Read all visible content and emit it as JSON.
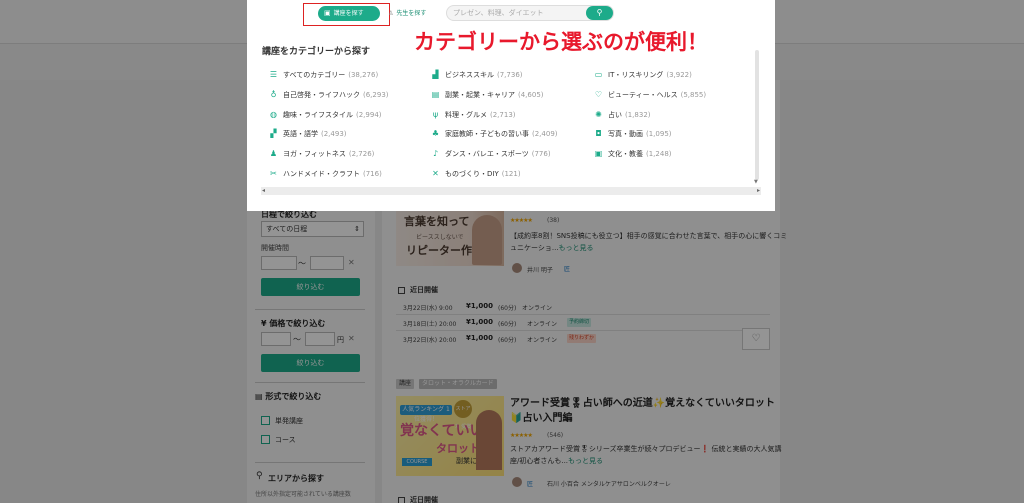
{
  "navbar": {
    "find_course_label": "講座を探す",
    "find_teacher_label": "先生を探す",
    "search_placeholder": "プレゼン、料理、ダイエット"
  },
  "annotation_text": "カテゴリーから選ぶのが便利！",
  "category_modal": {
    "title": "講座をカテゴリーから探す",
    "categories": [
      {
        "icon": "list-icon",
        "label": "すべてのカテゴリー",
        "count": "(38,276)"
      },
      {
        "icon": "chart-icon",
        "label": "ビジネススキル",
        "count": "(7,736)"
      },
      {
        "icon": "laptop-icon",
        "label": "IT・リスキリング",
        "count": "(3,922)"
      },
      {
        "icon": "lightbulb-icon",
        "label": "自己啓発・ライフハック",
        "count": "(6,293)"
      },
      {
        "icon": "briefcase-icon",
        "label": "副業・起業・キャリア",
        "count": "(4,605)"
      },
      {
        "icon": "heart-pulse-icon",
        "label": "ビューティー・ヘルス",
        "count": "(5,855)"
      },
      {
        "icon": "globe-icon",
        "label": "趣味・ライフスタイル",
        "count": "(2,994)"
      },
      {
        "icon": "cutlery-icon",
        "label": "料理・グルメ",
        "count": "(2,713)"
      },
      {
        "icon": "fortune-icon",
        "label": "占い",
        "count": "(1,832)"
      },
      {
        "icon": "chat-bubbles-icon",
        "label": "英語・語学",
        "count": "(2,493)"
      },
      {
        "icon": "family-icon",
        "label": "家庭教師・子どもの習い事",
        "count": "(2,409)"
      },
      {
        "icon": "camera-icon",
        "label": "写真・動画",
        "count": "(1,095)"
      },
      {
        "icon": "yoga-icon",
        "label": "ヨガ・フィットネス",
        "count": "(2,726)"
      },
      {
        "icon": "dance-icon",
        "label": "ダンス・バレエ・スポーツ",
        "count": "(776)"
      },
      {
        "icon": "book-icon",
        "label": "文化・教養",
        "count": "(1,248)"
      },
      {
        "icon": "scissors-icon",
        "label": "ハンドメイド・クラフト",
        "count": "(716)"
      },
      {
        "icon": "tools-icon",
        "label": "ものづくり・DIY",
        "count": "(121)"
      }
    ]
  },
  "sidebar": {
    "date_filter_title": "日程で絞り込む",
    "date_select_value": "すべての日程",
    "time_label": "開催時間",
    "tilde": "〜",
    "narrow_button": "絞り込む",
    "price_filter_title": "価格で絞り込む",
    "price_unit": "円",
    "format_filter_title": "形式で絞り込む",
    "format_options": [
      "単発講座",
      "コース"
    ],
    "area_title": "エリアから探す",
    "area_note": "住所以外指定可能されている講座数"
  },
  "courses": [
    {
      "thumb_line1": "言葉を知って",
      "thumb_line2": "ビーススしないで",
      "thumb_line3": "リピーター作り",
      "stars": "★★★★★",
      "reviews": "(38)",
      "description": "【成約率8割！SNS投稿にも役立つ】相手の感覚に合わせた言葉で、相手の心に響くコミュニケーショ...",
      "more": "もっと見る",
      "author": "井川 明子",
      "author_badge": "匠",
      "upcoming_title": "近日開催",
      "events": [
        {
          "date": "3月22日(水) 9:00",
          "price": "¥1,000",
          "duration": "(60分)",
          "type": "オンライン",
          "badge": ""
        },
        {
          "date": "3月18日(土) 20:00",
          "price": "¥1,000",
          "duration": "(60分)",
          "type": "オンライン",
          "badge": "予約締切"
        },
        {
          "date": "3月22日(水) 20:00",
          "price": "¥1,000",
          "duration": "(60分)",
          "type": "オンライン",
          "badge": "残りわずか"
        }
      ]
    },
    {
      "kind_badge": "講座",
      "category_badge": "タロット・オラクルカード",
      "title": "アワード受賞🎖占い師への近道✨覚えなくていいタロット🔰占い入門編",
      "thumb_rank": "人気ランキング 1位獲得！",
      "thumb_medal": "ストアカ 受賞",
      "thumb_big1": "覚なくていい",
      "thumb_big2": "タロット",
      "thumb_tag": "COURSE",
      "thumb_sub": "副業にも！",
      "stars": "★★★★★",
      "reviews": "(546)",
      "description": "ストアカアワード受賞🎖シリーズ卒業生が続々プロデビュー❗ 伝統と実績の大人気講座/初心者さんも...",
      "more": "もっと見る",
      "author": "石川 小百合  メンタルケアサロンベルクオーレ",
      "author_badge": "匠",
      "upcoming_title": "近日開催"
    }
  ]
}
